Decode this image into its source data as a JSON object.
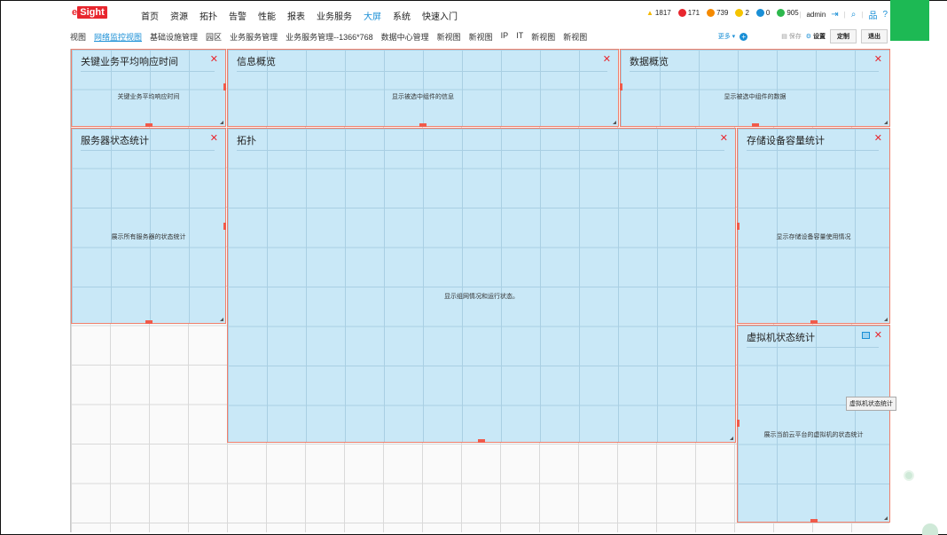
{
  "app": {
    "logo_prefix": "e",
    "logo_text": "Sight"
  },
  "nav": {
    "items": [
      "首页",
      "资源",
      "拓扑",
      "告警",
      "性能",
      "报表",
      "业务服务",
      "大屏",
      "系统",
      "快速入门"
    ],
    "active": "大屏"
  },
  "alerts": [
    {
      "value": "1817",
      "color": "#f5b800"
    },
    {
      "value": "171",
      "color": "#e8262e"
    },
    {
      "value": "739",
      "color": "#f58a00"
    },
    {
      "value": "2",
      "color": "#f5c400"
    },
    {
      "value": "0",
      "color": "#1a8fd6"
    },
    {
      "value": "905",
      "color": "#2db84d"
    }
  ],
  "user": {
    "name": "admin",
    "help": "?"
  },
  "tabs": {
    "items": [
      "视图",
      "网络监控视图",
      "基础设施管理",
      "园区",
      "业务服务管理",
      "业务服务管理--1366*768",
      "数据中心管理",
      "新视图",
      "新视图",
      "IP",
      "IT",
      "新视图",
      "新视图"
    ],
    "active": "网络监控视图",
    "more_label": "更多",
    "save_label": "保存",
    "settings_label": "设置",
    "customize_label": "定制",
    "exit_label": "退出"
  },
  "widgets": [
    {
      "id": "key-response",
      "title": "关键业务平均响应时间",
      "desc": "关键业务平均响应时间"
    },
    {
      "id": "info-overview",
      "title": "信息概览",
      "desc": "显示被选中组件的信息"
    },
    {
      "id": "data-overview",
      "title": "数据概览",
      "desc": "显示被选中组件的数据"
    },
    {
      "id": "server-status",
      "title": "服务器状态统计",
      "desc": "展示所有服务器的状态统计"
    },
    {
      "id": "topology",
      "title": "拓扑",
      "desc": "显示组网情况和运行状态。"
    },
    {
      "id": "storage-capacity",
      "title": "存储设备容量统计",
      "desc": "显示存储设备容量使用情况"
    },
    {
      "id": "vm-status",
      "title": "虚拟机状态统计",
      "desc": "展示当前云平台的虚拟机的状态统计"
    }
  ],
  "tooltip": "虚拟机状态统计",
  "colors": {
    "accent": "#1a8fd6",
    "brand": "#e8262e",
    "widget_bg": "#c9e8f7",
    "widget_border": "#f07f6b",
    "green_block": "#1db954"
  }
}
